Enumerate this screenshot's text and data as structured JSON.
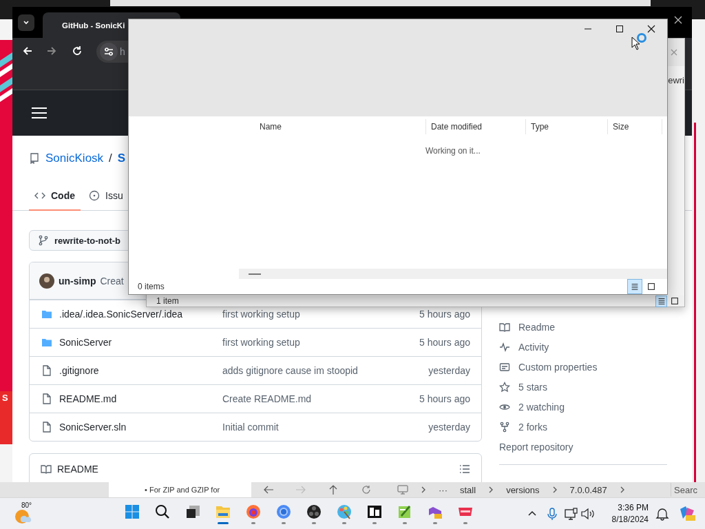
{
  "side_window": {
    "fragment": "S"
  },
  "browser": {
    "tab_title": "GitHub - SonicKi",
    "address": "h",
    "repo_owner": "SonicKiosk",
    "repo_separator": "/",
    "repo_name": "S",
    "nav_tabs": [
      {
        "kind": "code",
        "label": "Code",
        "selected": true
      },
      {
        "kind": "issues",
        "label": "Issu",
        "selected": false
      }
    ],
    "branch": "rewrite-to-not-b",
    "commit": {
      "author": "un-simp",
      "message": "Creat"
    },
    "files": [
      {
        "kind": "folder",
        "name": ".idea/.idea.SonicServer/.idea",
        "message": "first working setup",
        "time": "5 hours ago"
      },
      {
        "kind": "folder",
        "name": "SonicServer",
        "message": "first working setup",
        "time": "5 hours ago"
      },
      {
        "kind": "file",
        "name": ".gitignore",
        "message": "adds gitignore cause im stoopid",
        "time": "yesterday"
      },
      {
        "kind": "file",
        "name": "README.md",
        "message": "Create README.md",
        "time": "5 hours ago"
      },
      {
        "kind": "file",
        "name": "SonicServer.sln",
        "message": "Initial commit",
        "time": "yesterday"
      }
    ],
    "readme_title": "README",
    "about": [
      {
        "kind": "book",
        "label": "Readme"
      },
      {
        "kind": "pulse",
        "label": "Activity"
      },
      {
        "kind": "note",
        "label": "Custom properties"
      },
      {
        "kind": "star",
        "label": "5 stars"
      },
      {
        "kind": "eye",
        "label": "2 watching"
      },
      {
        "kind": "fork",
        "label": "2 forks"
      },
      {
        "kind": "plain",
        "label": "Report repository"
      }
    ]
  },
  "back_window": {
    "fragment": "ewri",
    "status": "1 item",
    "views": [
      {
        "kind": "details",
        "selected": true
      },
      {
        "kind": "tiles",
        "selected": false
      }
    ]
  },
  "file_dialog": {
    "columns": [
      "Name",
      "Date modified",
      "Type",
      "Size"
    ],
    "message": "Working on it...",
    "status": "0 items",
    "views": [
      {
        "kind": "details",
        "selected": true
      },
      {
        "kind": "tiles",
        "selected": false
      }
    ]
  },
  "explorer_bar": {
    "note": "• For ZIP and GZIP for",
    "more": "···",
    "path": [
      "stall",
      "versions",
      "7.0.0.487"
    ],
    "search": "Searc"
  },
  "taskbar": {
    "weather": "80°",
    "apps": [
      {
        "kind": "start",
        "running": false,
        "active": false
      },
      {
        "kind": "search",
        "running": false,
        "active": false
      },
      {
        "kind": "taskview",
        "running": false,
        "active": false
      },
      {
        "kind": "folder",
        "running": true,
        "active": true
      },
      {
        "kind": "firefox",
        "running": true,
        "active": false
      },
      {
        "kind": "chrome",
        "running": true,
        "active": false
      },
      {
        "kind": "obs",
        "running": true,
        "active": false
      },
      {
        "kind": "paint",
        "running": true,
        "active": false
      },
      {
        "kind": "sevenzip",
        "running": true,
        "active": false
      },
      {
        "kind": "notepad",
        "running": true,
        "active": false
      },
      {
        "kind": "studio",
        "running": true,
        "active": false
      },
      {
        "kind": "menu",
        "running": true,
        "active": false
      }
    ],
    "time": "3:36 PM",
    "date": "8/18/2024"
  }
}
